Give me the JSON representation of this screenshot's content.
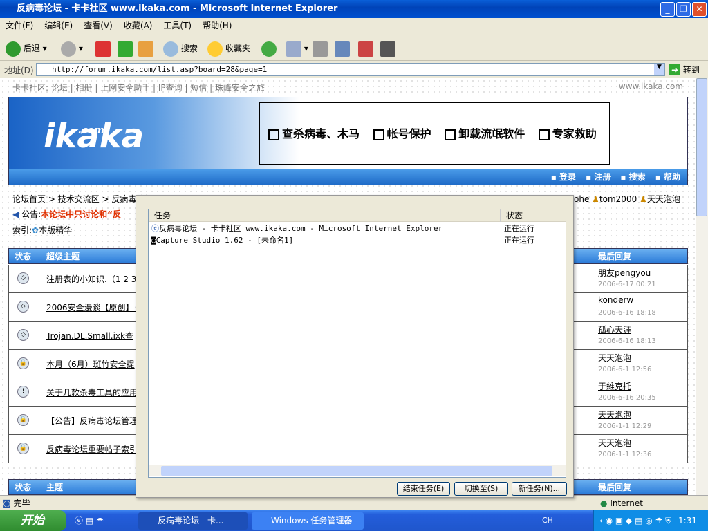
{
  "window": {
    "title": "反病毒论坛 - 卡卡社区 www.ikaka.com - Microsoft Internet Explorer"
  },
  "menu": [
    "文件(F)",
    "编辑(E)",
    "查看(V)",
    "收藏(A)",
    "工具(T)",
    "帮助(H)"
  ],
  "toolbar": {
    "back": "后退",
    "search": "搜索",
    "favorites": "收藏夹"
  },
  "address": {
    "label": "地址(D)",
    "url": "http://forum.ikaka.com/list.asp?board=28&page=1",
    "go": "转到"
  },
  "page": {
    "topnav": "卡卡社区: 论坛 | 相册 | 上网安全助手 | IP查询 | 短信 | 珠峰安全之旅",
    "site": "www.ikaka.com",
    "logo": "ikaka",
    "logo_com": ".com",
    "ad": [
      "查杀病毒、木马",
      "帐号保护",
      "卸载流氓软件",
      "专家救助"
    ],
    "nav": [
      "▪ 登录",
      "▪ 注册",
      "▪ 搜索",
      "▪ 帮助"
    ],
    "breadcrumb": [
      "论坛首页",
      "技术交流区",
      "反病毒论坛"
    ],
    "moderators": [
      "ohe",
      "tom2000",
      "天天泡泡"
    ],
    "notice_label": "公告:",
    "notice": "本论坛中只讨论和“反",
    "index_label": "索引:",
    "index_link": "本版精华",
    "header": {
      "status": "状态",
      "topic": "超级主题",
      "last": "最后回复"
    },
    "header2": {
      "status": "状态",
      "topic": "主题",
      "last": "最后回复"
    },
    "rows": [
      {
        "icon": "closed-topic-icon",
        "subject": "注册表的小知识.（1 2 3",
        "user": "朋友pengyou",
        "date": "2006-6-17 00:21"
      },
      {
        "icon": "closed-topic-icon",
        "subject": "2006安全漫谈【原创】（",
        "user": "konderw",
        "date": "2006-6-16 18:18"
      },
      {
        "icon": "closed-topic-icon",
        "subject": "Trojan.DL.Small.ixk查",
        "user": "孤心天涯",
        "date": "2006-6-16 18:13"
      },
      {
        "icon": "lock-icon",
        "subject": "本月（6月）斑竹安全提",
        "user": "天天泡泡",
        "date": "2006-6-1 12:56"
      },
      {
        "icon": "alert-topic-icon",
        "subject": "关于几款杀毒工具的应用",
        "user": "于維克托",
        "date": "2006-6-16 20:35"
      },
      {
        "icon": "lock-icon",
        "subject": "【公告】反病毒论坛管理",
        "user": "天天泡泡",
        "date": "2006-1-1 12:29"
      },
      {
        "icon": "lock-icon",
        "subject": "反病毒论坛重要帖子索引",
        "user": "天天泡泡",
        "date": "2006-1-1 12:36"
      }
    ]
  },
  "status": {
    "text": "完毕",
    "zone": "Internet"
  },
  "taskmgr": {
    "col_task": "任务",
    "col_status": "状态",
    "tasks": [
      {
        "name": "反病毒论坛 - 卡卡社区 www.ikaka.com - Microsoft Internet Explorer",
        "status": "正在运行"
      },
      {
        "name": "Capture Studio 1.62 - [未命名1]",
        "status": "正在运行"
      }
    ],
    "end": "结束任务(E)",
    "switch": "切换至(S)",
    "new": "新任务(N)..."
  },
  "taskbar": {
    "start": "开始",
    "tasks": [
      "反病毒论坛 - 卡...",
      "Windows 任务管理器"
    ],
    "lang": "CH",
    "clock": "1:31"
  }
}
